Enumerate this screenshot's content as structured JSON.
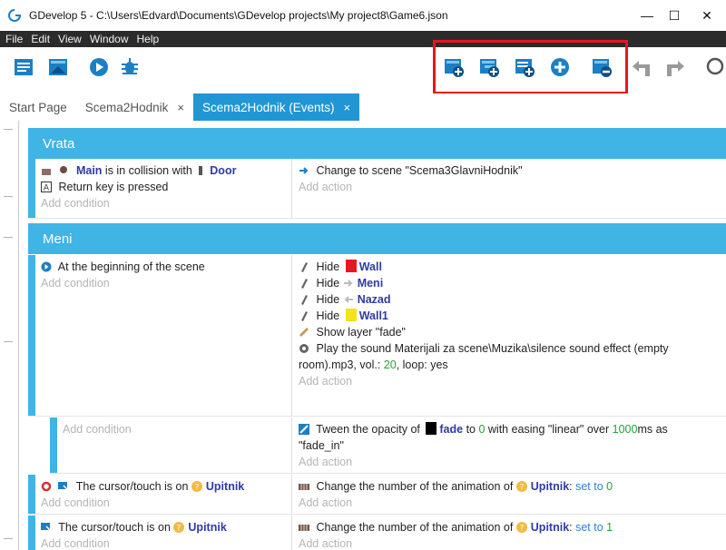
{
  "window": {
    "title": "GDevelop 5 - C:\\Users\\Edvard\\Documents\\GDevelop projects\\My project8\\Game6.json",
    "minimize": "—",
    "maximize": "☐",
    "close": "✕"
  },
  "menu": [
    "File",
    "Edit",
    "View",
    "Window",
    "Help"
  ],
  "tabs": [
    {
      "label": "Start Page",
      "close": ""
    },
    {
      "label": "Scema2Hodnik",
      "close": "×"
    },
    {
      "label": "Scema2Hodnik (Events)",
      "close": "×"
    }
  ],
  "groups": [
    {
      "name": "Vrata"
    },
    {
      "name": "Meni"
    }
  ],
  "events": {
    "e1": {
      "c1": {
        "obj": "Main",
        "text": " is in collision with ",
        "obj2": "Door"
      },
      "c2": {
        "text": "Return key is pressed"
      },
      "add_condition": "Add condition",
      "a1": {
        "text": "Change to scene \"Scema3GlavniHodnik\""
      },
      "add_action": "Add action"
    },
    "e2": {
      "c1": {
        "text": "At the beginning of the scene"
      },
      "add_condition": "Add condition",
      "a_hide": [
        {
          "verb": "Hide",
          "obj": "Wall",
          "color": "#e8161e"
        },
        {
          "verb": "Hide",
          "obj": "Meni",
          "color": "#bdbdbd"
        },
        {
          "verb": "Hide",
          "obj": "Nazad",
          "color": "#bdbdbd"
        },
        {
          "verb": "Hide",
          "obj": "Wall1",
          "color": "#f5e11c"
        }
      ],
      "a_layer": "Show layer \"fade\"",
      "a_sound_1": "Play the sound Materijali za scene\\Muzika\\silence sound effect (empty",
      "a_sound_2_prefix": "room).mp3, vol.: ",
      "a_sound_vol": "20",
      "a_sound_loop": ", loop: yes",
      "add_action": "Add action"
    },
    "e3": {
      "add_condition": "Add condition",
      "a1_prefix": "Tween the opacity of ",
      "a1_obj": "fade",
      "a1_to": " to ",
      "a1_val": "0",
      "a1_mid": " with easing \"linear\" over ",
      "a1_ms": "1000",
      "a1_end": "ms as",
      "a1_line2": "\"fade_in\"",
      "add_action": "Add action"
    },
    "e4": {
      "c1_text": "The cursor/touch is on ",
      "c1_obj": "Upitnik",
      "add_condition": "Add condition",
      "a1_prefix": "Change the number of the animation of ",
      "a1_obj": "Upitnik",
      "a1_sep": ": ",
      "a1_op": "set to",
      "a1_val": "0",
      "add_action": "Add action"
    },
    "e5": {
      "c1_text": "The cursor/touch is on ",
      "c1_obj": "Upitnik",
      "add_condition": "Add condition",
      "a1_prefix": "Change the number of the animation of ",
      "a1_obj": "Upitnik",
      "a1_sep": ": ",
      "a1_op": "set to",
      "a1_val": "1",
      "add_action": "Add action"
    }
  },
  "icons": {
    "toolbar_left": [
      "project-manager-icon",
      "scene-editor-icon",
      "preview-icon",
      "debugger-icon"
    ],
    "toolbar_right": [
      "add-event-icon",
      "add-subevent-icon",
      "add-comment-icon",
      "add-more-icon",
      "delete-event-icon",
      "undo-icon",
      "redo-icon",
      "search-icon"
    ]
  },
  "colors": {
    "accent": "#2196d4",
    "group_header": "#3fb4e5",
    "highlight_box": "#e8161e",
    "menubar": "#2b2b2b"
  }
}
